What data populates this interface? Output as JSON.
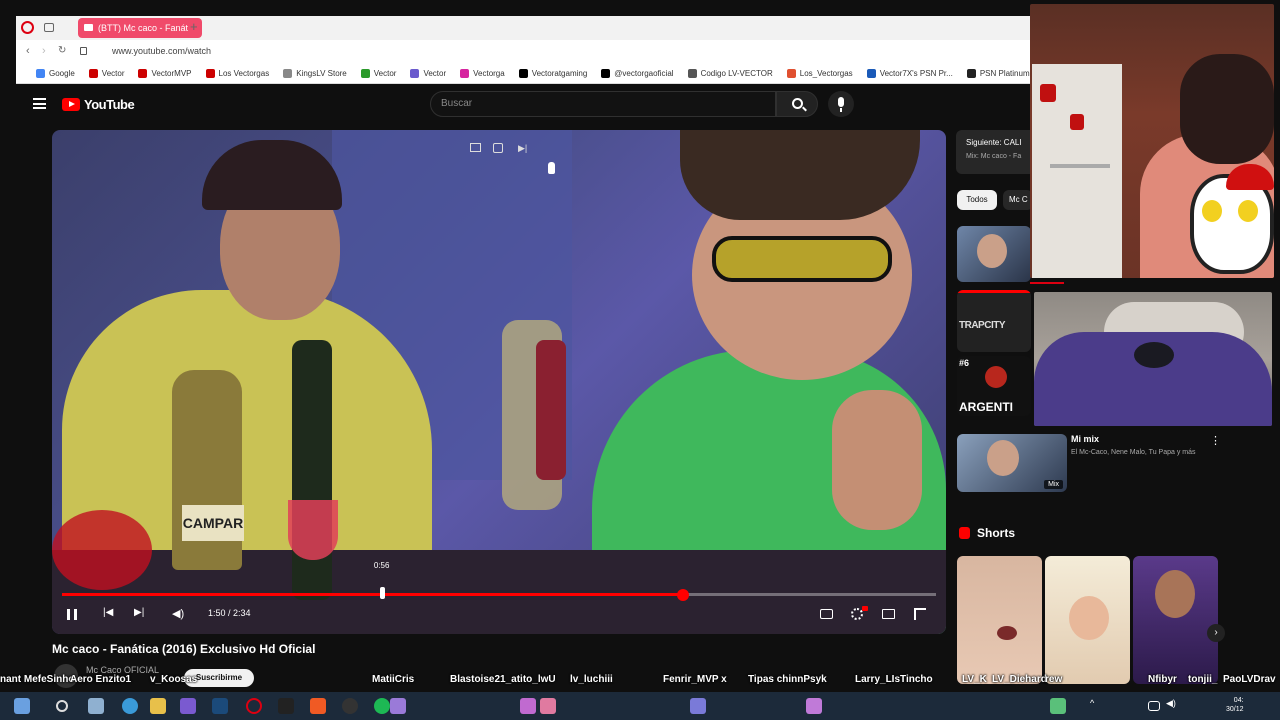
{
  "browser": {
    "tab_title": "(BTT) Mc caco - Fanát",
    "url": "www.youtube.com/watch",
    "bookmarks": [
      "Google",
      "Vector",
      "VectorMVP",
      "Los Vectorgas",
      "KingsLV Store",
      "Vector",
      "Vector",
      "Vectorga",
      "Vectoratgaming",
      "@vectorgaoficial",
      "Codigo LV-VECTOR",
      "Los_Vectorgas",
      "Vector7X's PSN Pr...",
      "PSN Platinum Mo"
    ]
  },
  "youtube": {
    "logo": "YouTube",
    "search_placeholder": "Buscar"
  },
  "player": {
    "time": "1:50 / 2:34",
    "hover_time": "0:56",
    "progress_fraction": 0.71,
    "hover_fraction": 0.366
  },
  "video": {
    "title": "Mc caco - Fanática (2016) Exclusivo Hd Oficial",
    "channel": "Mc Caco OFICIAL",
    "subscribe_label": "Suscribirme",
    "overlay_text": "CAMPAR"
  },
  "sidebar": {
    "next_label": "Siguiente: CALI",
    "next_sub": "Mix: Mc caco - Fa",
    "chips": [
      "Todos",
      "Mc C"
    ],
    "rank": "#6",
    "rank_text": "ARGENTI",
    "trapcity": "TRAPCITY",
    "mix_title": "Mi mix",
    "mix_sub": "El Mc-Caco, Nene Malo, Tu Papa y más",
    "mix_badge": "Mix",
    "shorts_label": "Shorts"
  },
  "chat_ticker": [
    "nant MefeSinho",
    "Aero Enzito1",
    "v_Koosas",
    "MatiiCris",
    "Blastoise21_atito_lwU",
    "lv_luchiii",
    "Fenrir_MVP x",
    "Tipas chinnPsyk",
    "Larry_LIsTincho",
    "LV_K",
    "LV_Diehard",
    "rew",
    "Nfibyr",
    "tonjii_",
    "PaoLVDrav"
  ],
  "clock": {
    "time": "04:",
    "date": "30/12"
  }
}
